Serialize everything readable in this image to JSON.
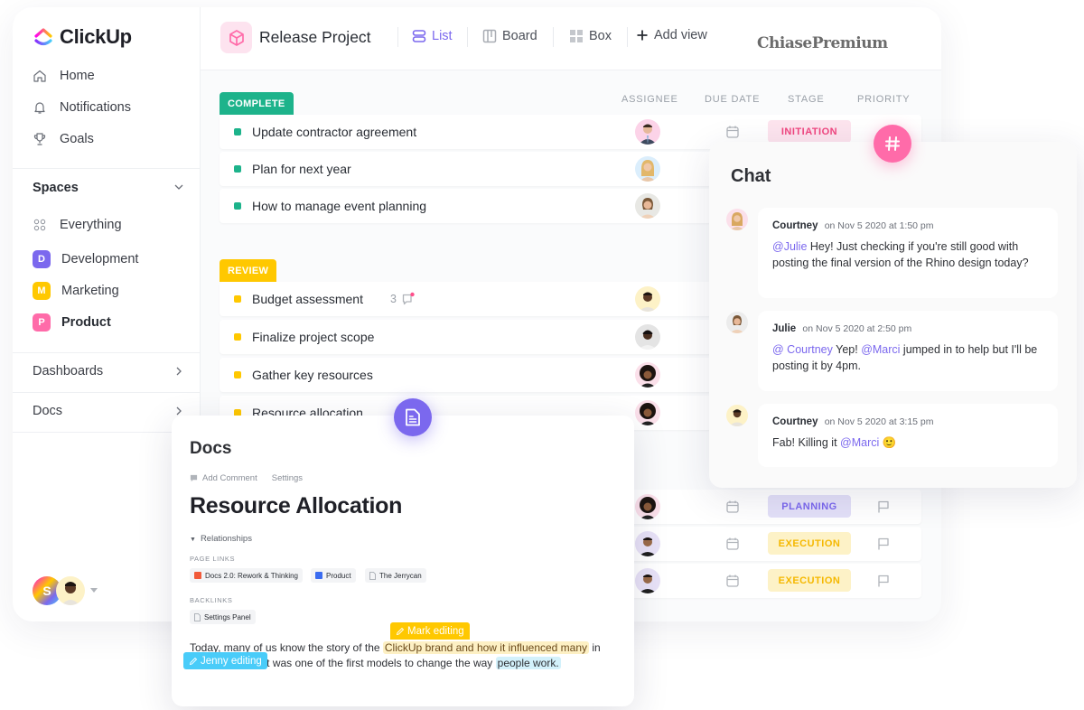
{
  "app": {
    "logo_text": "ClickUp",
    "watermark": "ChiasePremium"
  },
  "sidebar": {
    "nav": [
      {
        "label": "Home",
        "icon": "home-icon"
      },
      {
        "label": "Notifications",
        "icon": "bell-icon"
      },
      {
        "label": "Goals",
        "icon": "trophy-icon"
      }
    ],
    "spaces_title": "Spaces",
    "everything_label": "Everything",
    "spaces": [
      {
        "letter": "D",
        "label": "Development",
        "color": "#7b68ee"
      },
      {
        "letter": "M",
        "label": "Marketing",
        "color": "#ffc800"
      },
      {
        "letter": "P",
        "label": "Product",
        "color": "#ff6ba9"
      }
    ],
    "dashboards_label": "Dashboards",
    "docs_label": "Docs",
    "user_initial": "S"
  },
  "header": {
    "project_title": "Release Project",
    "views": [
      {
        "label": "List",
        "active": true
      },
      {
        "label": "Board",
        "active": false
      },
      {
        "label": "Box",
        "active": false
      }
    ],
    "add_view_label": "Add view"
  },
  "columns": [
    "ASSIGNEE",
    "DUE DATE",
    "STAGE",
    "PRIORITY"
  ],
  "groups": [
    {
      "status": "COMPLETE",
      "color": "#1db38b",
      "tasks": [
        {
          "name": "Update contractor agreement",
          "stage": "INITIATION"
        },
        {
          "name": "Plan for next year"
        },
        {
          "name": "How to manage event planning"
        }
      ]
    },
    {
      "status": "REVIEW",
      "color": "#ffc800",
      "tasks": [
        {
          "name": "Budget assessment",
          "comments": "3"
        },
        {
          "name": "Finalize project scope"
        },
        {
          "name": "Gather key resources"
        },
        {
          "name": "Resource allocation"
        }
      ]
    }
  ],
  "lower_rows": [
    {
      "stage": "PLANNING"
    },
    {
      "stage": "EXECUTION"
    },
    {
      "stage": "EXECUTION"
    }
  ],
  "chat": {
    "title": "Chat",
    "messages": [
      {
        "author": "Courtney",
        "time": "on Nov 5 2020 at 1:50 pm",
        "mention1": "@Julie",
        "text1": " Hey! Just checking if you're still good with posting the final version of the Rhino design today?"
      },
      {
        "author": "Julie",
        "time": "on Nov 5 2020 at 2:50 pm",
        "mention1": "@ Courtney",
        "text1": " Yep! ",
        "mention2": "@Marci",
        "text2": " jumped in to help but I'll be posting it by 4pm."
      },
      {
        "author": "Courtney",
        "time": "on Nov 5 2020 at 3:15 pm",
        "text1": "Fab! Killing it ",
        "mention1": "@Marci",
        "emoji": "🙂"
      }
    ]
  },
  "docs": {
    "title": "Docs",
    "add_comment": "Add Comment",
    "settings": "Settings",
    "heading": "Resource Allocation",
    "relationships": "Relationships",
    "page_links_label": "PAGE LINKS",
    "page_links": [
      "Docs 2.0: Rework & Thinking",
      "Product",
      "The Jerrycan"
    ],
    "backlinks_label": "BACKLINKS",
    "backlinks": [
      "Settings Panel"
    ],
    "mark_editing": "Mark editing",
    "jenny_editing": "Jenny editing",
    "text_a": "Today, many of us know the story of the ",
    "text_highlight": "ClickUp brand and how it influenced many",
    "text_b": " in the 21 century. It was one of the first models  to change the way ",
    "text_blue": "people work."
  }
}
